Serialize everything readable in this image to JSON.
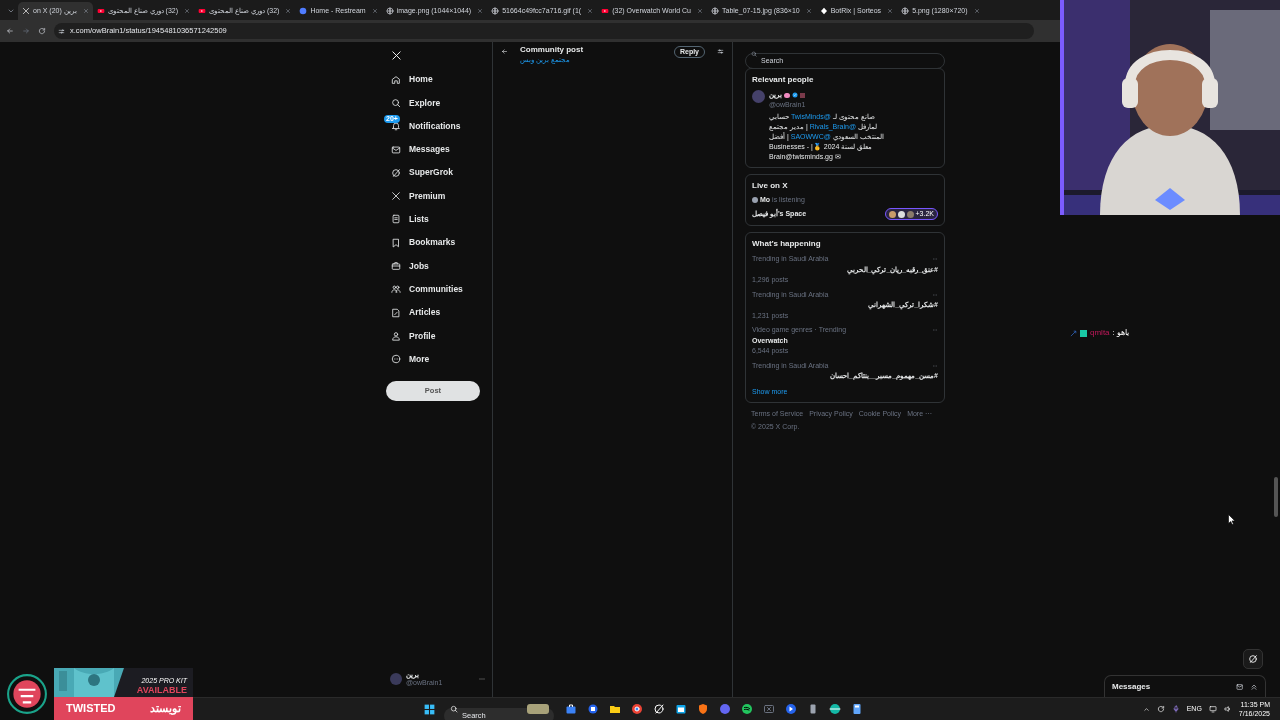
{
  "browser": {
    "tabs": [
      {
        "title": "on X برين (20)",
        "selected": true
      },
      {
        "title": "(32) دوري صناع المحتوى",
        "selected": false
      },
      {
        "title": "(32) دوري صناع المحتوى",
        "selected": false
      },
      {
        "title": "Home - Restream",
        "selected": false
      },
      {
        "title": "image.png (1044×1044)",
        "selected": false
      },
      {
        "title": "51664c49fcc7a716.gif (1(",
        "selected": false
      },
      {
        "title": "(32) Overwatch World Cu",
        "selected": false
      },
      {
        "title": "Table_07-15.jpg (836×10",
        "selected": false
      },
      {
        "title": "BotRix | Sorteos",
        "selected": false
      },
      {
        "title": "5.png (1280×720)",
        "selected": false
      }
    ],
    "url": "x.com/owBrain1/status/1945481036571242509"
  },
  "nav": {
    "items": [
      {
        "label": "Home"
      },
      {
        "label": "Explore"
      },
      {
        "label": "Notifications",
        "badge": "20+"
      },
      {
        "label": "Messages"
      },
      {
        "label": "SuperGrok"
      },
      {
        "label": "Premium"
      },
      {
        "label": "Lists"
      },
      {
        "label": "Bookmarks"
      },
      {
        "label": "Jobs"
      },
      {
        "label": "Communities"
      },
      {
        "label": "Articles"
      },
      {
        "label": "Profile"
      },
      {
        "label": "More"
      }
    ],
    "post_button": "Post",
    "account": {
      "name": "برين",
      "handle": "@owBrain1"
    }
  },
  "post_header": {
    "title": "Community post",
    "subtitle": "مجتمع برين وبس",
    "reply_button": "Reply"
  },
  "right": {
    "search": {
      "placeholder": "Search"
    },
    "relevant_people": {
      "title": "Relevant people",
      "person": {
        "name": "برين",
        "handle": "@owBrain1",
        "bio": [
          [
            {
              "text": "صانع محتوى لـ "
            },
            {
              "text": "@TwisMinds",
              "link": true
            },
            {
              "text": " حسابي"
            }
          ],
          [
            {
              "text": "لمارفل "
            },
            {
              "text": "@Rivals_Brain",
              "link": true
            },
            {
              "text": " | مدير مجتمع"
            }
          ],
          [
            {
              "text": "المنتخب السعودي "
            },
            {
              "text": "@SAOWWC",
              "link": true
            },
            {
              "text": " | أفضل"
            }
          ],
          [
            {
              "text": "معلق لسنة 2024 🥇| - Businesses"
            }
          ],
          [
            {
              "text": "✉ Brain@twisminds.gg"
            }
          ]
        ]
      }
    },
    "live": {
      "title": "Live on X",
      "listener": "Mo",
      "listener_status": "is listening",
      "space": "أبو فيصل's Space",
      "count": "+3.2K"
    },
    "happening": {
      "title": "What’s happening",
      "trends": [
        {
          "meta": "Trending in Saudi Arabia",
          "title": "#عنق_رقبه_ريان_تركي_الحربي",
          "posts": "1,296 posts"
        },
        {
          "meta": "Trending in Saudi Arabia",
          "title": "#شكرا_تركي_الشهراني",
          "posts": "1,231 posts"
        },
        {
          "meta": "Video game genres · Trending",
          "title": "Overwatch",
          "posts": "6,544 posts"
        },
        {
          "meta": "Trending in Saudi Arabia",
          "title": "#مسن_مهموم_مسبر__بنتاكم_احسان"
        }
      ],
      "show_more": "Show more"
    },
    "footer": [
      "Terms of Service",
      "Privacy Policy",
      "Cookie Policy",
      "More ···",
      "© 2025 X Corp."
    ]
  },
  "messages_drawer": {
    "title": "Messages"
  },
  "chat": {
    "user": "qmlta",
    "message": ": ياهو"
  },
  "sponsor": {
    "line1": "2025 PRO KIT",
    "line2": "AVAILABLE",
    "brand_latin": "TWISTED",
    "brand_arabic": "تويستد"
  },
  "taskbar": {
    "search": {
      "placeholder": "Search"
    },
    "language": "ENG",
    "time": "11:35 PM",
    "date": "7/16/2025"
  }
}
